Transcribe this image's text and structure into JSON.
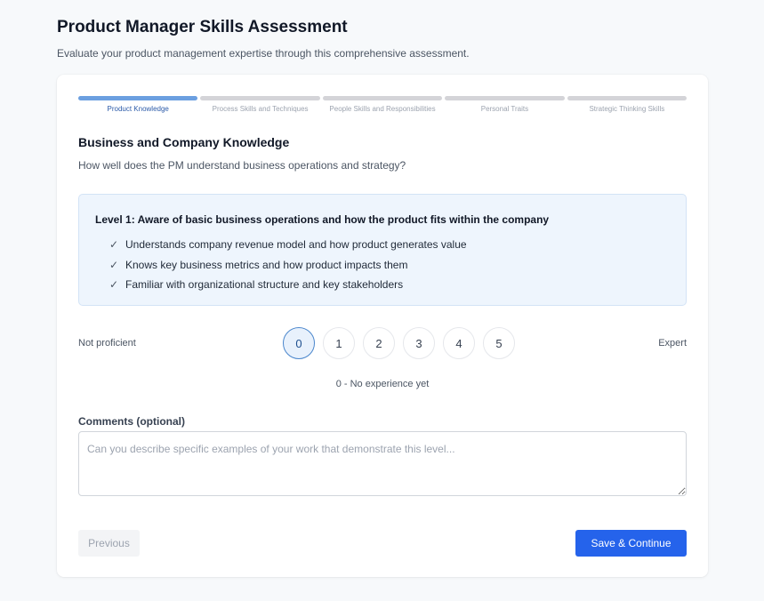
{
  "header": {
    "title": "Product Manager Skills Assessment",
    "subtitle": "Evaluate your product management expertise through this comprehensive assessment."
  },
  "steps": [
    {
      "label": "Product Knowledge",
      "active": true
    },
    {
      "label": "Process Skills and Techniques",
      "active": false
    },
    {
      "label": "People Skills and Responsibilities",
      "active": false
    },
    {
      "label": "Personal Traits",
      "active": false
    },
    {
      "label": "Strategic Thinking Skills",
      "active": false
    }
  ],
  "question": {
    "title": "Business and Company Knowledge",
    "description": "How well does the PM understand business operations and strategy?"
  },
  "level": {
    "heading": "Level 1: Aware of basic business operations and how the product fits within the company",
    "check_glyph": "✓",
    "items": [
      "Understands company revenue model and how product generates value",
      "Knows key business metrics and how product impacts them",
      "Familiar with organizational structure and key stakeholders"
    ]
  },
  "scale": {
    "min_label": "Not proficient",
    "max_label": "Expert",
    "options": [
      "0",
      "1",
      "2",
      "3",
      "4",
      "5"
    ],
    "selected": "0",
    "caption": "0 - No experience yet"
  },
  "comments": {
    "label": "Comments (optional)",
    "placeholder": "Can you describe specific examples of your work that demonstrate this level...",
    "value": ""
  },
  "actions": {
    "previous_label": "Previous",
    "save_label": "Save & Continue"
  },
  "colors": {
    "accent": "#2563eb",
    "step_active": "#6b9fe0",
    "level_bg": "#eef5fd"
  }
}
